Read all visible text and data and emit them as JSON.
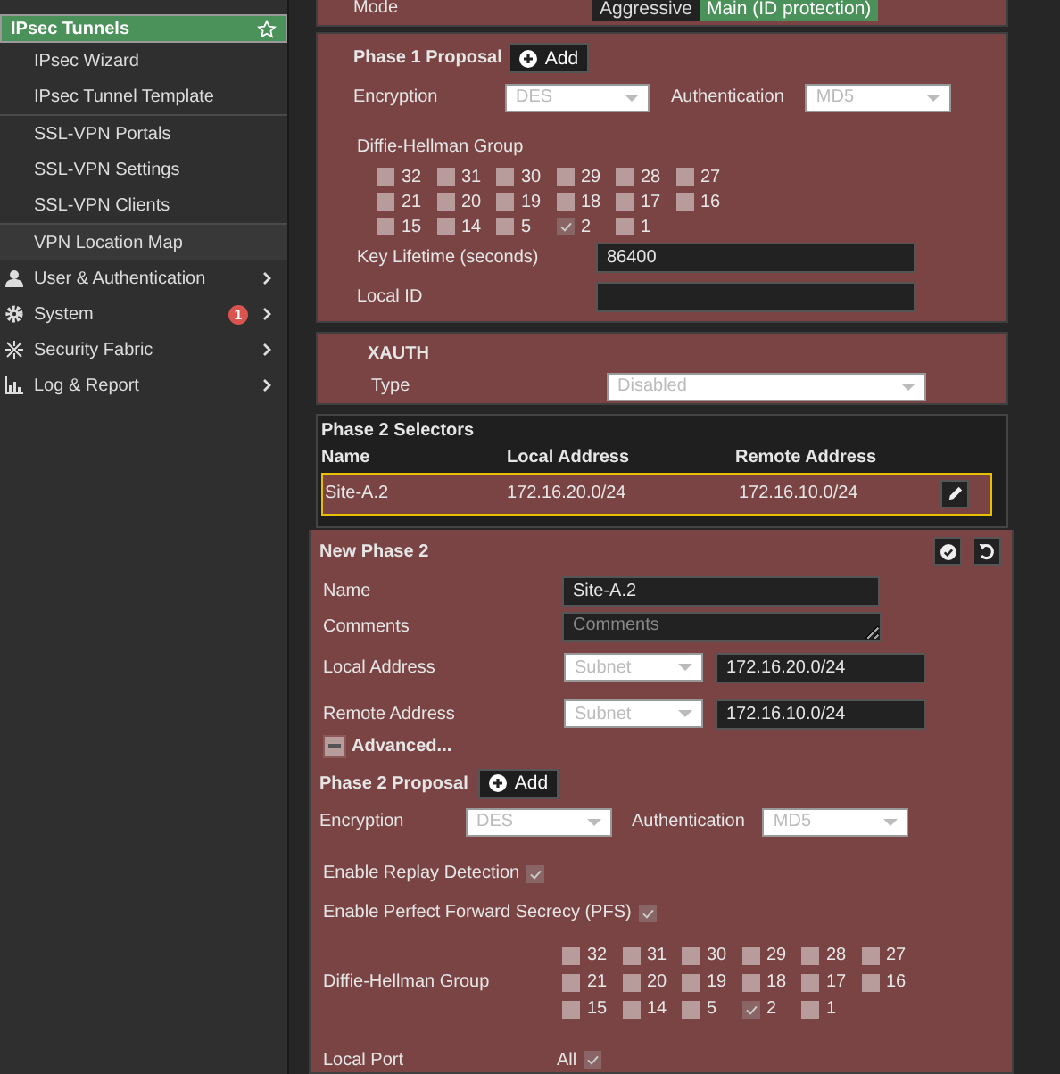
{
  "sidebar": {
    "vpn_groups": [
      [
        {
          "label": "IPsec Tunnels",
          "selected": true,
          "starred": true
        },
        {
          "label": "IPsec Wizard",
          "selected": false,
          "starred": false
        },
        {
          "label": "IPsec Tunnel Template",
          "selected": false,
          "starred": false
        }
      ],
      [
        {
          "label": "SSL-VPN Portals",
          "selected": false,
          "starred": false
        },
        {
          "label": "SSL-VPN Settings",
          "selected": false,
          "starred": false
        },
        {
          "label": "SSL-VPN Clients",
          "selected": false,
          "starred": false
        }
      ],
      [
        {
          "label": "VPN Location Map",
          "selected": false,
          "starred": false
        }
      ]
    ],
    "menu": [
      {
        "label": "User & Authentication",
        "kind": "user"
      },
      {
        "label": "System",
        "kind": "gear",
        "badge": "1"
      },
      {
        "label": "Security Fabric",
        "kind": "fabric"
      },
      {
        "label": "Log & Report",
        "kind": "chart"
      }
    ]
  },
  "mode": {
    "label": "Mode",
    "options": [
      {
        "label": "Aggressive",
        "selected": false
      },
      {
        "label": "Main (ID protection)",
        "selected": true
      }
    ]
  },
  "phase1": {
    "title": "Phase 1 Proposal",
    "add_button": "Add",
    "encryption": {
      "label": "Encryption",
      "value": "DES"
    },
    "authentication": {
      "label": "Authentication",
      "value": "MD5"
    },
    "dh_group": {
      "label": "Diffie-Hellman Group",
      "options": [
        {
          "label": "32",
          "checked": false
        },
        {
          "label": "31",
          "checked": false
        },
        {
          "label": "30",
          "checked": false
        },
        {
          "label": "29",
          "checked": false
        },
        {
          "label": "28",
          "checked": false
        },
        {
          "label": "27",
          "checked": false
        },
        {
          "label": "21",
          "checked": false
        },
        {
          "label": "20",
          "checked": false
        },
        {
          "label": "19",
          "checked": false
        },
        {
          "label": "18",
          "checked": false
        },
        {
          "label": "17",
          "checked": false
        },
        {
          "label": "16",
          "checked": false
        },
        {
          "label": "15",
          "checked": false
        },
        {
          "label": "14",
          "checked": false
        },
        {
          "label": "5",
          "checked": false
        },
        {
          "label": "2",
          "checked": true
        },
        {
          "label": "1",
          "checked": false
        }
      ]
    },
    "key_lifetime": {
      "label": "Key Lifetime (seconds)",
      "value": "86400"
    },
    "local_id": {
      "label": "Local ID"
    }
  },
  "xauth": {
    "title": "XAUTH",
    "type": {
      "label": "Type",
      "value": "Disabled"
    }
  },
  "selectors": {
    "title": "Phase 2 Selectors",
    "columns": [
      "Name",
      "Local Address",
      "Remote Address"
    ],
    "rows": [
      {
        "name": "Site-A.2",
        "local": "172.16.20.0/24",
        "remote": "172.16.10.0/24"
      }
    ]
  },
  "phase2": {
    "title": "New Phase 2",
    "name": {
      "label": "Name",
      "value": "Site-A.2"
    },
    "comments": {
      "label": "Comments",
      "placeholder": "Comments"
    },
    "local_address": {
      "label": "Local Address",
      "type": "Subnet",
      "value": "172.16.20.0/24"
    },
    "remote_address": {
      "label": "Remote Address",
      "type": "Subnet",
      "value": "172.16.10.0/24"
    },
    "advanced": {
      "label": "Advanced...",
      "expanded": true
    },
    "proposal_title": "Phase 2 Proposal",
    "add_button": "Add",
    "encryption": {
      "label": "Encryption",
      "value": "DES"
    },
    "authentication": {
      "label": "Authentication",
      "value": "MD5"
    },
    "replay_detection": {
      "label": "Enable Replay Detection",
      "checked": true
    },
    "pfs": {
      "label": "Enable Perfect Forward Secrecy (PFS)",
      "checked": true
    },
    "dh_group": {
      "label": "Diffie-Hellman Group",
      "options": [
        {
          "label": "32",
          "checked": false
        },
        {
          "label": "31",
          "checked": false
        },
        {
          "label": "30",
          "checked": false
        },
        {
          "label": "29",
          "checked": false
        },
        {
          "label": "28",
          "checked": false
        },
        {
          "label": "27",
          "checked": false
        },
        {
          "label": "21",
          "checked": false
        },
        {
          "label": "20",
          "checked": false
        },
        {
          "label": "19",
          "checked": false
        },
        {
          "label": "18",
          "checked": false
        },
        {
          "label": "17",
          "checked": false
        },
        {
          "label": "16",
          "checked": false
        },
        {
          "label": "15",
          "checked": false
        },
        {
          "label": "14",
          "checked": false
        },
        {
          "label": "5",
          "checked": false
        },
        {
          "label": "2",
          "checked": true
        },
        {
          "label": "1",
          "checked": false
        }
      ]
    },
    "local_port": {
      "label": "Local Port",
      "value": "All",
      "checked": true
    }
  }
}
